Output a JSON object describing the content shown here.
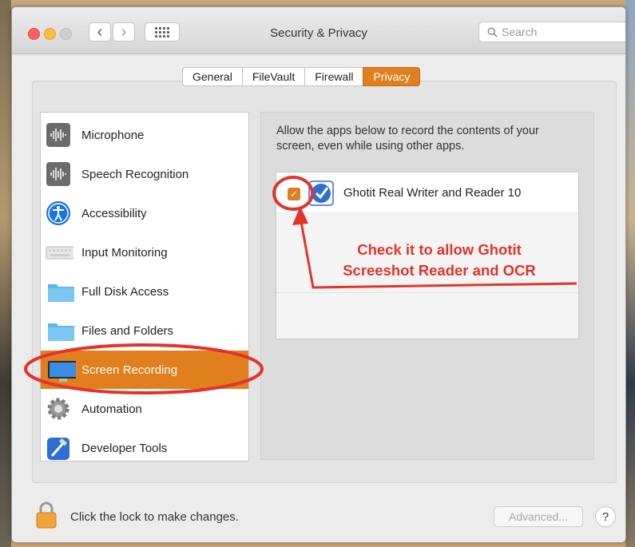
{
  "window": {
    "title": "Security & Privacy"
  },
  "toolbar": {
    "back": "‹",
    "forward": "›"
  },
  "search": {
    "placeholder": "Search"
  },
  "tabs": [
    {
      "label": "General",
      "active": false
    },
    {
      "label": "FileVault",
      "active": false
    },
    {
      "label": "Firewall",
      "active": false
    },
    {
      "label": "Privacy",
      "active": true
    }
  ],
  "sidebar": {
    "items": [
      {
        "label": "Microphone",
        "icon": "microphone-waveform-icon"
      },
      {
        "label": "Speech Recognition",
        "icon": "speech-waveform-icon"
      },
      {
        "label": "Accessibility",
        "icon": "accessibility-icon"
      },
      {
        "label": "Input Monitoring",
        "icon": "keyboard-icon"
      },
      {
        "label": "Full Disk Access",
        "icon": "folder-icon"
      },
      {
        "label": "Files and Folders",
        "icon": "folder-icon"
      },
      {
        "label": "Screen Recording",
        "icon": "monitor-icon",
        "selected": true
      },
      {
        "label": "Automation",
        "icon": "gear-icon"
      },
      {
        "label": "Developer Tools",
        "icon": "hammer-icon"
      }
    ]
  },
  "main": {
    "description": "Allow the apps below to record the contents of your screen, even while using other apps.",
    "apps": [
      {
        "name": "Ghotit Real Writer and Reader 10",
        "checked": true
      }
    ]
  },
  "annotation": {
    "line1": "Check it to allow Ghotit",
    "line2": "Screeshot Reader and OCR",
    "color": "#e3342c"
  },
  "footer": {
    "lock_text": "Click the lock to make changes.",
    "advanced_label": "Advanced...",
    "help_label": "?"
  },
  "colors": {
    "accent": "#e07f1f"
  }
}
